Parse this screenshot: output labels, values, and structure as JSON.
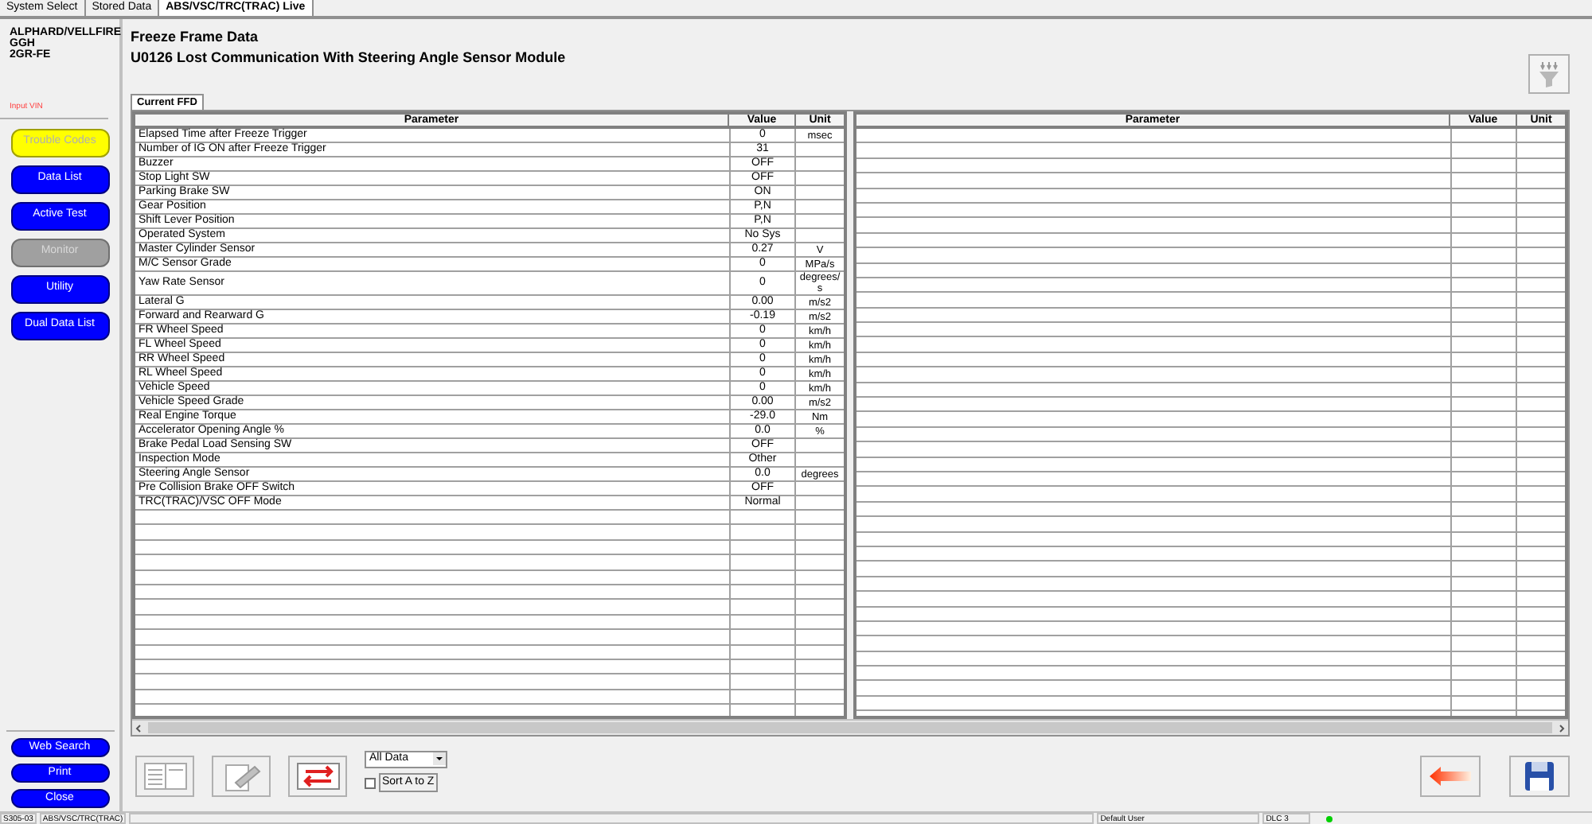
{
  "top_tabs": [
    {
      "label": "System Select",
      "selected": false
    },
    {
      "label": "Stored Data",
      "selected": false
    },
    {
      "label": "ABS/VSC/TRC(TRAC) Live",
      "selected": true
    }
  ],
  "vehicle": [
    "ALPHARD/VELLFIRE",
    "GGH",
    "2GR-FE"
  ],
  "input_vin": "Input VIN",
  "nav_buttons": [
    {
      "label": "Trouble Codes",
      "selected": true,
      "disabled": false
    },
    {
      "label": "Data List",
      "selected": false,
      "disabled": false
    },
    {
      "label": "Active Test",
      "selected": false,
      "disabled": false
    },
    {
      "label": "Monitor",
      "selected": false,
      "disabled": true
    },
    {
      "label": "Utility",
      "selected": false,
      "disabled": false
    },
    {
      "label": "Dual Data List",
      "selected": false,
      "disabled": false
    }
  ],
  "bottom_buttons": [
    "Web Search",
    "Print",
    "Close"
  ],
  "title": "Freeze Frame Data",
  "subtitle": "U0126 Lost Communication With Steering Angle Sensor Module",
  "tabs": [
    {
      "label": "Current FFD",
      "selected": true
    }
  ],
  "table": {
    "columns": [
      "Parameter",
      "Value",
      "Unit"
    ],
    "rows": [
      [
        "Elapsed Time after Freeze Trigger",
        "0",
        "msec"
      ],
      [
        "Number of IG ON after Freeze Trigger",
        "31",
        ""
      ],
      [
        "Buzzer",
        "OFF",
        ""
      ],
      [
        "Stop Light SW",
        "OFF",
        ""
      ],
      [
        "Parking Brake SW",
        "ON",
        ""
      ],
      [
        "Gear Position",
        "P,N",
        ""
      ],
      [
        "Shift Lever Position",
        "P,N",
        ""
      ],
      [
        "Operated System",
        "No Sys",
        ""
      ],
      [
        "Master Cylinder Sensor",
        "0.27",
        "V"
      ],
      [
        "M/C Sensor Grade",
        "0",
        "MPa/s"
      ],
      [
        "Yaw Rate Sensor",
        "0",
        "degrees/ s"
      ],
      [
        "Lateral G",
        "0.00",
        "m/s2"
      ],
      [
        "Forward and Rearward G",
        "-0.19",
        "m/s2"
      ],
      [
        "FR Wheel Speed",
        "0",
        "km/h"
      ],
      [
        "FL Wheel Speed",
        "0",
        "km/h"
      ],
      [
        "RR Wheel Speed",
        "0",
        "km/h"
      ],
      [
        "RL Wheel Speed",
        "0",
        "km/h"
      ],
      [
        "Vehicle Speed",
        "0",
        "km/h"
      ],
      [
        "Vehicle Speed Grade",
        "0.00",
        "m/s2"
      ],
      [
        "Real Engine Torque",
        "-29.0",
        "Nm"
      ],
      [
        "Accelerator Opening Angle %",
        "0.0",
        "%"
      ],
      [
        "Brake Pedal Load Sensing SW",
        "OFF",
        ""
      ],
      [
        "Inspection Mode",
        "Other",
        ""
      ],
      [
        "Steering Angle Sensor",
        "0.0",
        "degrees"
      ],
      [
        "Pre Collision Brake OFF Switch",
        "OFF",
        ""
      ],
      [
        "TRC(TRAC)/VSC OFF Mode",
        "Normal",
        ""
      ]
    ]
  },
  "table_2": {
    "columns": [
      "Parameter",
      "Value",
      "Unit"
    ]
  },
  "filter": {
    "value": "All Data"
  },
  "sort": {
    "label": "Sort A to Z",
    "checked": false
  },
  "status_bar": [
    "S305-03",
    "ABS/VSC/TRC(TRAC)",
    "Default User",
    "DLC 3"
  ]
}
